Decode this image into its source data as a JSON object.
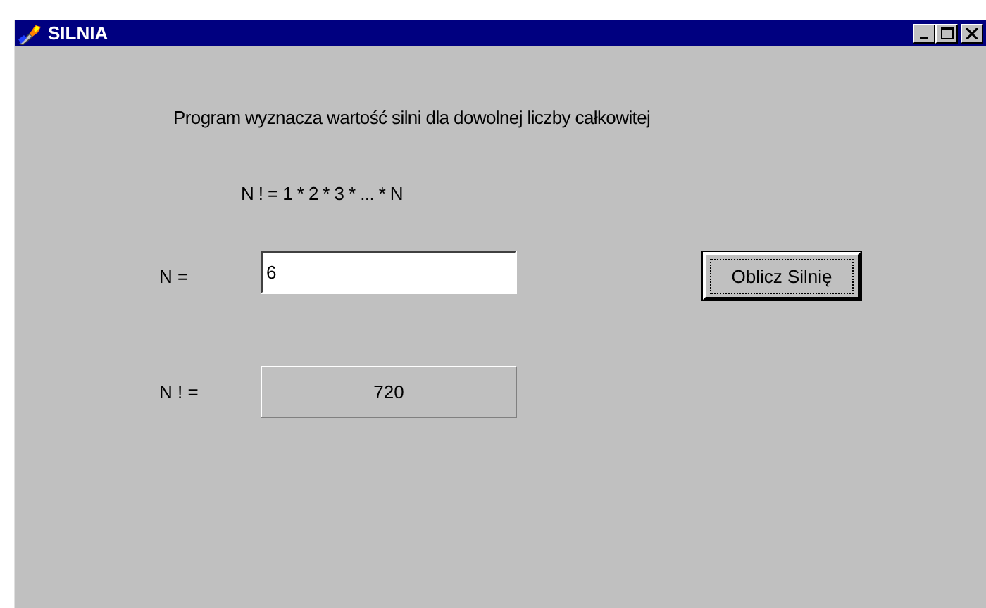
{
  "window": {
    "title": "SILNIA"
  },
  "description": "Program wyznacza wartość silni dla dowolnej liczby całkowitej",
  "formula": "N ! = 1 * 2 * 3 * ... * N",
  "input": {
    "label": "N =",
    "value": "6"
  },
  "button": {
    "label": "Oblicz Silnię"
  },
  "result": {
    "label": "N ! =",
    "value": "720"
  }
}
